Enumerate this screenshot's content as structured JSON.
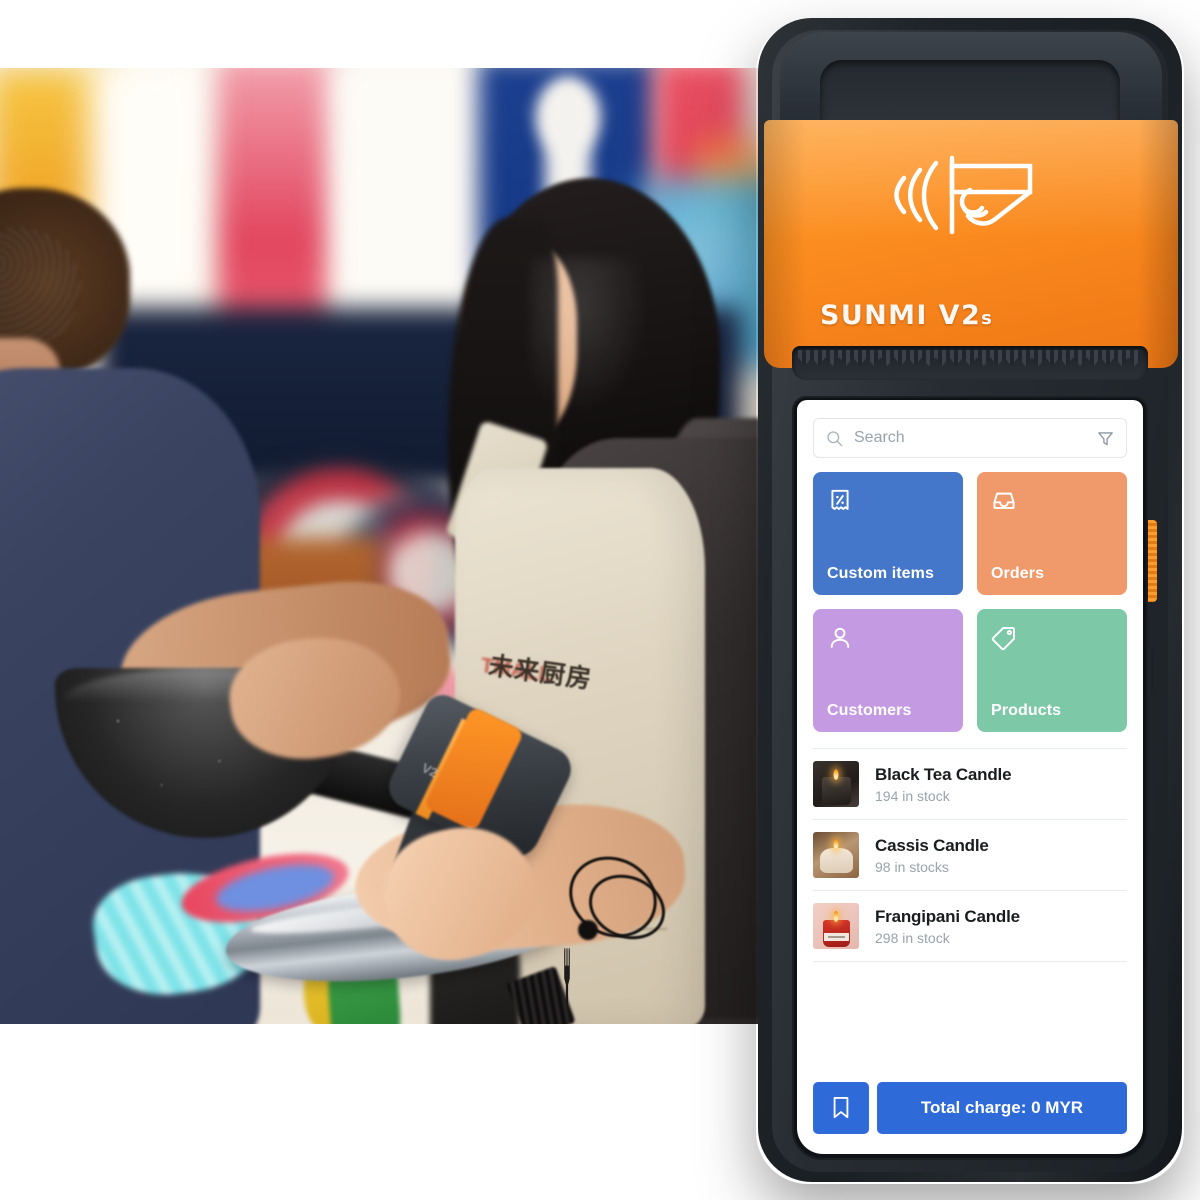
{
  "device": {
    "brand_label": "SUNMI V2",
    "brand_sub": "s",
    "nfc_icon": "contactless-payment-icon"
  },
  "app": {
    "search": {
      "placeholder": "Search",
      "value": "",
      "search_icon": "search-icon",
      "filter_icon": "filter-funnel-icon"
    },
    "tiles": [
      {
        "label": "Custom items",
        "icon": "receipt-percent-icon",
        "color": "#4476c9"
      },
      {
        "label": "Orders",
        "icon": "inbox-tray-icon",
        "color": "#f0996b"
      },
      {
        "label": "Customers",
        "icon": "person-icon",
        "color": "#c49ae2"
      },
      {
        "label": "Products",
        "icon": "price-tag-icon",
        "color": "#7dc9a7"
      }
    ],
    "products": [
      {
        "name": "Black Tea Candle",
        "stock": "194 in stock",
        "thumb": "black-tea-candle-photo"
      },
      {
        "name": "Cassis Candle",
        "stock": "98 in stocks",
        "thumb": "cassis-candle-photo"
      },
      {
        "name": "Frangipani Candle",
        "stock": "298 in stock",
        "thumb": "frangipani-candle-photo"
      }
    ],
    "bottom_bar": {
      "bookmark_icon": "bookmark-icon",
      "charge_label": "Total charge: 0 MYR"
    }
  },
  "photo": {
    "apron_text_cn": "未来厨房",
    "apron_text_brand": "TMALL",
    "scanner_label": "V2"
  },
  "colors": {
    "primary_blue": "#2f6ad9",
    "tile_blue": "#4476c9",
    "tile_orange": "#f0996b",
    "tile_purple": "#c49ae2",
    "tile_green": "#7dc9a7",
    "device_orange": "#fb8c1f",
    "device_dark": "#20252a",
    "text_dark": "#1a1d20",
    "text_muted": "#9aa2ab"
  }
}
